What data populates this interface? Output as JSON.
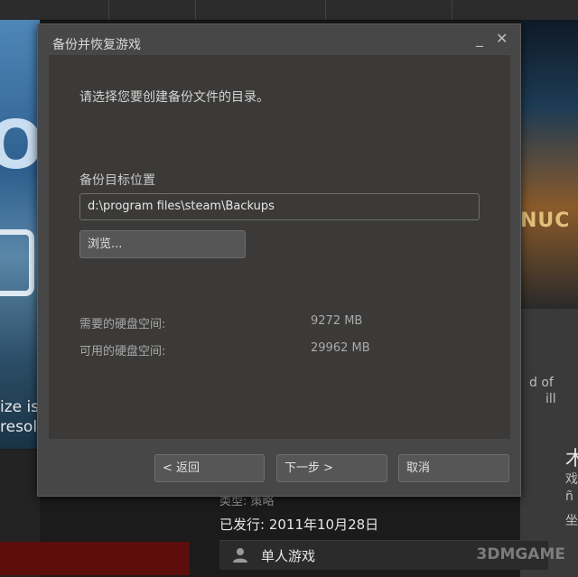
{
  "background": {
    "left_art_text_line1": "ize is",
    "left_art_text_line2": "resol",
    "right_art_logo": "NUC",
    "right_panel_text_1": "d of",
    "right_panel_text_2": "ill",
    "right_panel_text_3": "木",
    "right_panel_text_4": "戏",
    "right_panel_text_5": "ñ",
    "right_panel_text_6": "坐",
    "developer_row": "类型: 策略",
    "release_date_row": "已发行: 2011年10月28日",
    "game_mode_label": "单人游戏",
    "watermark": "3DMGAME"
  },
  "dialog": {
    "title": "备份并恢复游戏",
    "minimize_glyph": "_",
    "close_glyph": "✕",
    "instruction": "请选择您要创建备份文件的目录。",
    "target_label": "备份目标位置",
    "target_path": "d:\\program files\\steam\\Backups",
    "browse_label": "浏览...",
    "required_space_label": "需要的硬盘空间:",
    "required_space_value": "9272 MB",
    "available_space_label": "可用的硬盘空间:",
    "available_space_value": "29962 MB",
    "back_label": "< 返回",
    "next_label": "下一步 >",
    "cancel_label": "取消"
  },
  "colors": {
    "dialog_bg": "#474747",
    "content_bg": "#3b3a39",
    "button_bg": "#565656",
    "text_primary": "#d8d8d8",
    "text_muted": "#a9a9a9"
  },
  "icons": {
    "person": "person-icon",
    "minimize": "minimize-icon",
    "close": "close-icon"
  }
}
